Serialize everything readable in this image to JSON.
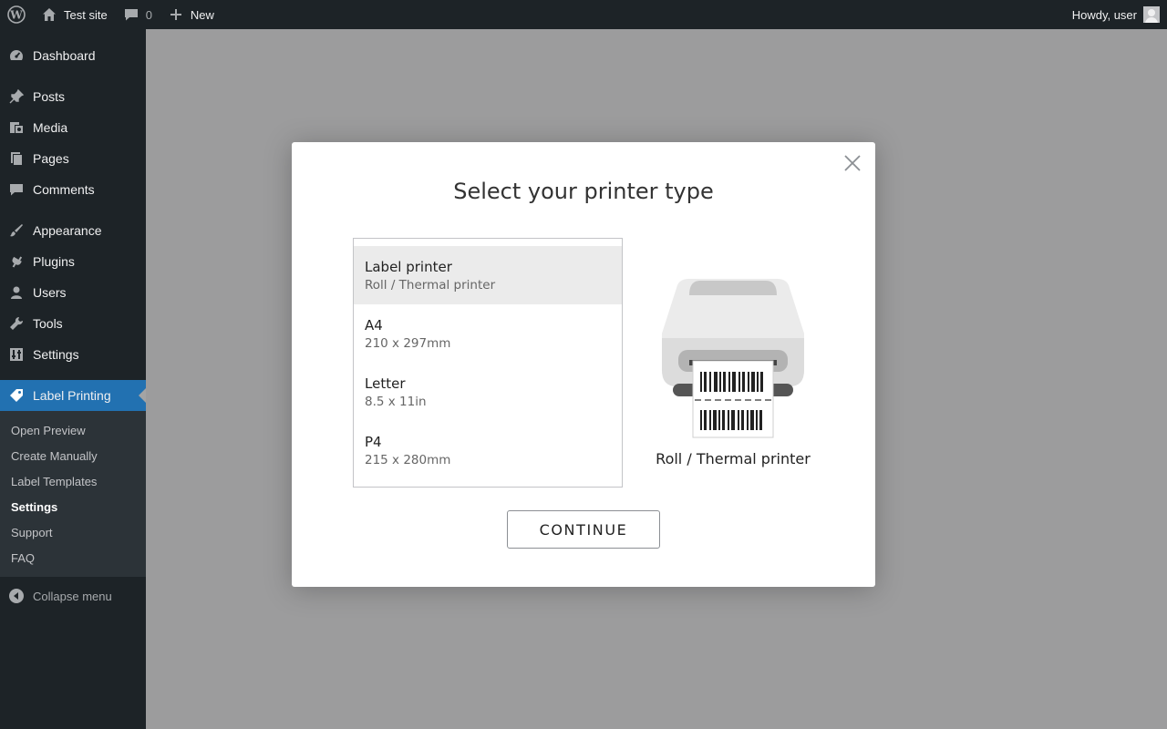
{
  "adminbar": {
    "site_name": "Test site",
    "comments_count": "0",
    "new_label": "New",
    "howdy": "Howdy, user"
  },
  "sidebar": {
    "items": [
      {
        "label": "Dashboard",
        "icon": "dashboard-icon"
      },
      {
        "label": "Posts",
        "icon": "pin-icon"
      },
      {
        "label": "Media",
        "icon": "media-icon"
      },
      {
        "label": "Pages",
        "icon": "pages-icon"
      },
      {
        "label": "Comments",
        "icon": "comment-icon"
      },
      {
        "label": "Appearance",
        "icon": "brush-icon"
      },
      {
        "label": "Plugins",
        "icon": "plug-icon"
      },
      {
        "label": "Users",
        "icon": "user-icon"
      },
      {
        "label": "Tools",
        "icon": "wrench-icon"
      },
      {
        "label": "Settings",
        "icon": "settings-icon"
      },
      {
        "label": "Label Printing",
        "icon": "tag-icon"
      }
    ],
    "submenu": [
      {
        "label": "Open Preview"
      },
      {
        "label": "Create Manually"
      },
      {
        "label": "Label Templates"
      },
      {
        "label": "Settings"
      },
      {
        "label": "Support"
      },
      {
        "label": "FAQ"
      }
    ],
    "collapse_label": "Collapse menu"
  },
  "modal": {
    "title": "Select your printer type",
    "options": [
      {
        "title": "Label printer",
        "subtitle": "Roll / Thermal printer"
      },
      {
        "title": "A4",
        "subtitle": "210 x 297mm"
      },
      {
        "title": "Letter",
        "subtitle": "8.5 x 11in"
      },
      {
        "title": "P4",
        "subtitle": "215 x 280mm"
      }
    ],
    "selected_index": 0,
    "preview_caption": "Roll / Thermal printer",
    "continue_label": "CONTINUE"
  },
  "colors": {
    "adminbar_bg": "#1d2327",
    "sidebar_active": "#2271b1",
    "selected_option_bg": "#ebebeb"
  }
}
